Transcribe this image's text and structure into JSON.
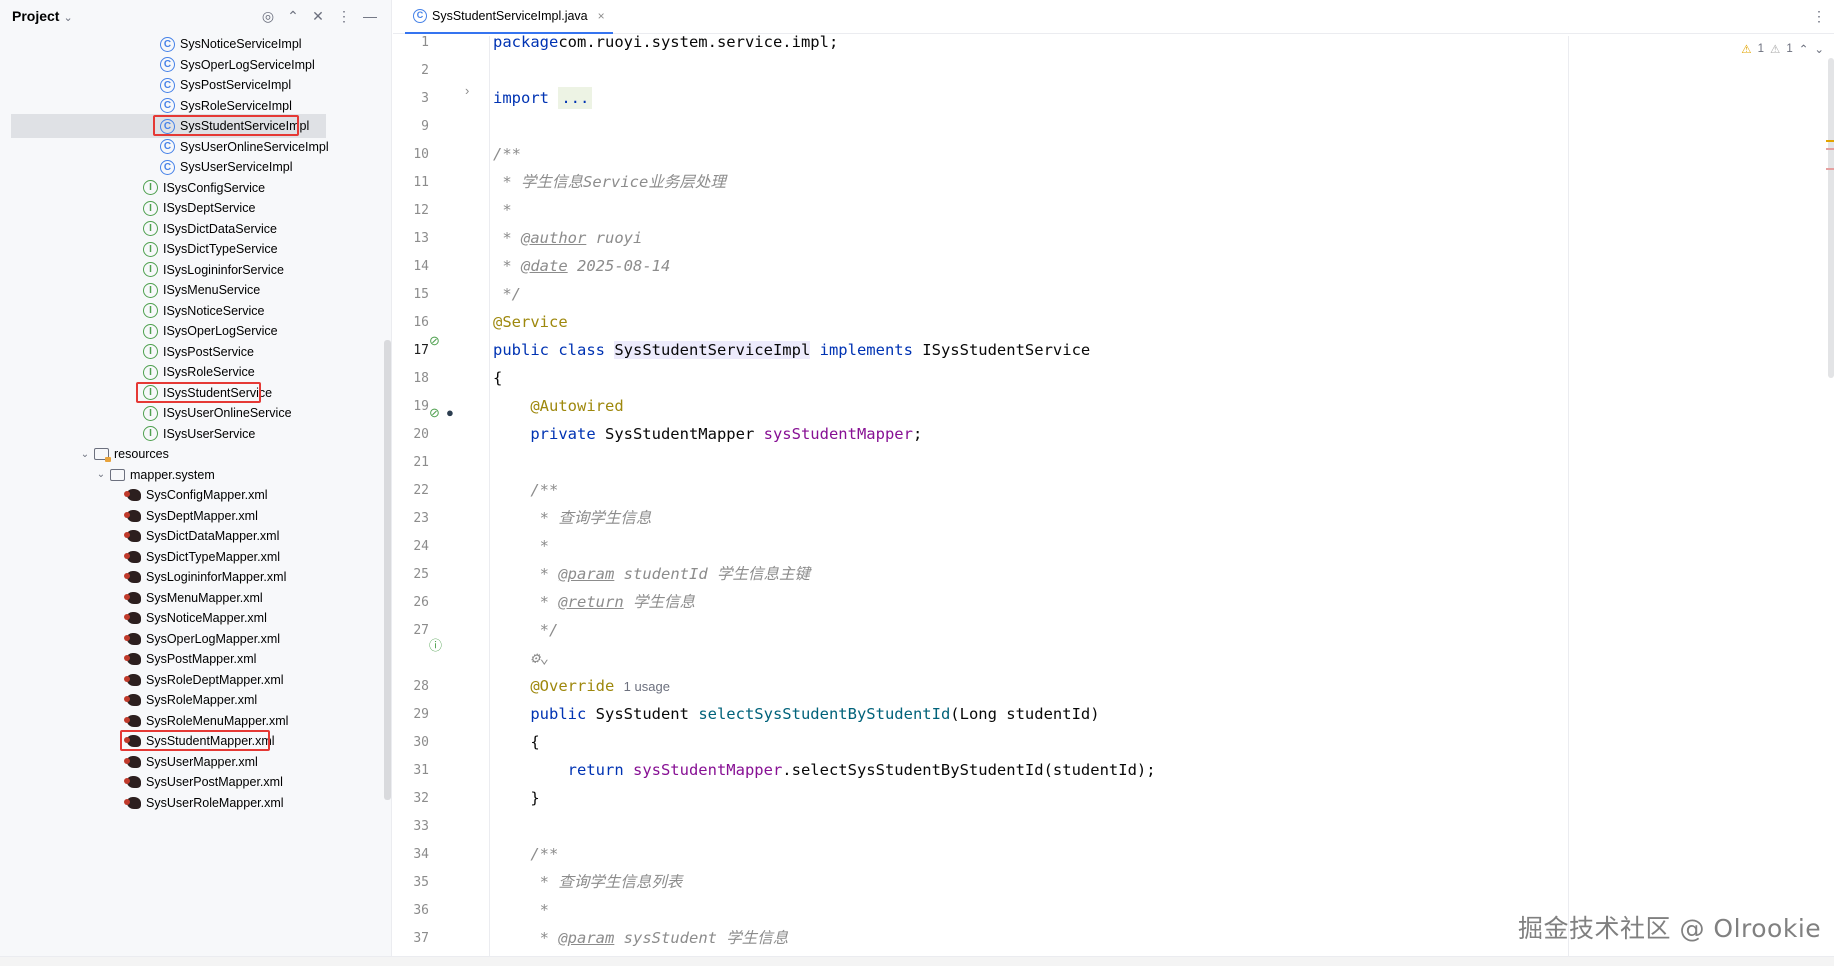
{
  "project_panel": {
    "title": "Project",
    "header_icons": [
      "locate-icon",
      "expand-icon",
      "collapse-icon",
      "more-icon",
      "minimize-icon"
    ],
    "tree": [
      {
        "label": "SysNoticeServiceImpl",
        "kind": "class"
      },
      {
        "label": "SysOperLogServiceImpl",
        "kind": "class"
      },
      {
        "label": "SysPostServiceImpl",
        "kind": "class"
      },
      {
        "label": "SysRoleServiceImpl",
        "kind": "class"
      },
      {
        "label": "SysStudentServiceImpl",
        "kind": "class",
        "selected": true,
        "highlighted": true
      },
      {
        "label": "SysUserOnlineServiceImpl",
        "kind": "class"
      },
      {
        "label": "SysUserServiceImpl",
        "kind": "class"
      },
      {
        "label": "ISysConfigService",
        "kind": "interface"
      },
      {
        "label": "ISysDeptService",
        "kind": "interface"
      },
      {
        "label": "ISysDictDataService",
        "kind": "interface"
      },
      {
        "label": "ISysDictTypeService",
        "kind": "interface"
      },
      {
        "label": "ISysLogininforService",
        "kind": "interface"
      },
      {
        "label": "ISysMenuService",
        "kind": "interface"
      },
      {
        "label": "ISysNoticeService",
        "kind": "interface"
      },
      {
        "label": "ISysOperLogService",
        "kind": "interface"
      },
      {
        "label": "ISysPostService",
        "kind": "interface"
      },
      {
        "label": "ISysRoleService",
        "kind": "interface"
      },
      {
        "label": "ISysStudentService",
        "kind": "interface",
        "highlighted": true
      },
      {
        "label": "ISysUserOnlineService",
        "kind": "interface"
      },
      {
        "label": "ISysUserService",
        "kind": "interface"
      },
      {
        "label": "resources",
        "kind": "folder-resources",
        "expanded": true
      },
      {
        "label": "mapper.system",
        "kind": "folder",
        "expanded": true
      },
      {
        "label": "SysConfigMapper.xml",
        "kind": "xml"
      },
      {
        "label": "SysDeptMapper.xml",
        "kind": "xml"
      },
      {
        "label": "SysDictDataMapper.xml",
        "kind": "xml"
      },
      {
        "label": "SysDictTypeMapper.xml",
        "kind": "xml"
      },
      {
        "label": "SysLogininforMapper.xml",
        "kind": "xml"
      },
      {
        "label": "SysMenuMapper.xml",
        "kind": "xml"
      },
      {
        "label": "SysNoticeMapper.xml",
        "kind": "xml"
      },
      {
        "label": "SysOperLogMapper.xml",
        "kind": "xml"
      },
      {
        "label": "SysPostMapper.xml",
        "kind": "xml"
      },
      {
        "label": "SysRoleDeptMapper.xml",
        "kind": "xml"
      },
      {
        "label": "SysRoleMapper.xml",
        "kind": "xml"
      },
      {
        "label": "SysRoleMenuMapper.xml",
        "kind": "xml"
      },
      {
        "label": "SysStudentMapper.xml",
        "kind": "xml",
        "highlighted": true
      },
      {
        "label": "SysUserMapper.xml",
        "kind": "xml"
      },
      {
        "label": "SysUserPostMapper.xml",
        "kind": "xml"
      },
      {
        "label": "SysUserRoleMapper.xml",
        "kind": "xml"
      }
    ]
  },
  "editor": {
    "tab": {
      "label": "SysStudentServiceImpl.java",
      "close": "×"
    },
    "inspections": {
      "warnings": "1",
      "weak_warnings": "1",
      "warn_glyph": "⚠"
    },
    "code_lines": [
      {
        "n": "1",
        "tokens": [
          [
            "kw",
            "package"
          ],
          [
            "",
            "com.ruoyi.system.service.impl;"
          ]
        ]
      },
      {
        "n": "2",
        "tokens": []
      },
      {
        "n": "3",
        "tokens": [
          [
            "kw",
            "import"
          ],
          [
            "",
            " "
          ],
          [
            "fold",
            "..."
          ]
        ]
      },
      {
        "n": "9",
        "tokens": []
      },
      {
        "n": "10",
        "tokens": [
          [
            "cmt",
            "/**"
          ]
        ]
      },
      {
        "n": "11",
        "tokens": [
          [
            "cmt",
            " * 学生信息Service业务层处理"
          ]
        ]
      },
      {
        "n": "12",
        "tokens": [
          [
            "cmt",
            " *"
          ]
        ]
      },
      {
        "n": "13",
        "tokens": [
          [
            "cmt",
            " * "
          ],
          [
            "doctag",
            "@author"
          ],
          [
            "cmt",
            " ruoyi"
          ]
        ]
      },
      {
        "n": "14",
        "tokens": [
          [
            "cmt",
            " * "
          ],
          [
            "doctag",
            "@date"
          ],
          [
            "cmt",
            " 2025-08-14"
          ]
        ]
      },
      {
        "n": "15",
        "tokens": [
          [
            "cmt",
            " */"
          ]
        ]
      },
      {
        "n": "16",
        "tokens": [
          [
            "ann",
            "@Service"
          ]
        ]
      },
      {
        "n": "17",
        "tokens": [
          [
            "kw",
            "public class "
          ],
          [
            "hl-cls",
            "SysStudentServiceImpl"
          ],
          [
            "kw",
            " implements "
          ],
          [
            "",
            "ISysStudentService"
          ]
        ]
      },
      {
        "n": "18",
        "tokens": [
          [
            "",
            "{"
          ]
        ]
      },
      {
        "n": "19",
        "tokens": [
          [
            "",
            "    "
          ],
          [
            "ann",
            "@Autowired"
          ]
        ]
      },
      {
        "n": "20",
        "tokens": [
          [
            "",
            "    "
          ],
          [
            "kw",
            "private "
          ],
          [
            "",
            "SysStudentMapper "
          ],
          [
            "field",
            "sysStudentMapper"
          ],
          [
            "",
            ";"
          ]
        ]
      },
      {
        "n": "21",
        "tokens": []
      },
      {
        "n": "22",
        "tokens": [
          [
            "cmt",
            "    /**"
          ]
        ]
      },
      {
        "n": "23",
        "tokens": [
          [
            "cmt",
            "     * 查询学生信息"
          ]
        ]
      },
      {
        "n": "24",
        "tokens": [
          [
            "cmt",
            "     *"
          ]
        ]
      },
      {
        "n": "25",
        "tokens": [
          [
            "cmt",
            "     * "
          ],
          [
            "doctag",
            "@param"
          ],
          [
            "cmt",
            " studentId 学生信息主键"
          ]
        ]
      },
      {
        "n": "26",
        "tokens": [
          [
            "cmt",
            "     * "
          ],
          [
            "doctag",
            "@return"
          ],
          [
            "cmt",
            " 学生信息"
          ]
        ]
      },
      {
        "n": "27",
        "tokens": [
          [
            "cmt",
            "     */"
          ]
        ]
      },
      {
        "n": "",
        "tokens": [
          [
            "cmt",
            "    ⚙⌄"
          ]
        ]
      },
      {
        "n": "28",
        "tokens": [
          [
            "",
            "    "
          ],
          [
            "ann",
            "@Override"
          ],
          [
            "",
            " "
          ],
          [
            "hint",
            "1 usage"
          ]
        ]
      },
      {
        "n": "29",
        "tokens": [
          [
            "",
            "    "
          ],
          [
            "kw",
            "public "
          ],
          [
            "",
            "SysStudent "
          ],
          [
            "meth",
            "selectSysStudentByStudentId"
          ],
          [
            "",
            "(Long studentId)"
          ]
        ]
      },
      {
        "n": "30",
        "tokens": [
          [
            "",
            "    {"
          ]
        ]
      },
      {
        "n": "31",
        "tokens": [
          [
            "",
            "        "
          ],
          [
            "kw",
            "return "
          ],
          [
            "field",
            "sysStudentMapper"
          ],
          [
            "",
            ".selectSysStudentByStudentId(studentId);"
          ]
        ]
      },
      {
        "n": "32",
        "tokens": [
          [
            "",
            "    }"
          ]
        ]
      },
      {
        "n": "33",
        "tokens": []
      },
      {
        "n": "34",
        "tokens": [
          [
            "cmt",
            "    /**"
          ]
        ]
      },
      {
        "n": "35",
        "tokens": [
          [
            "cmt",
            "     * 查询学生信息列表"
          ]
        ]
      },
      {
        "n": "36",
        "tokens": [
          [
            "cmt",
            "     *"
          ]
        ]
      },
      {
        "n": "37",
        "tokens": [
          [
            "cmt",
            "     * "
          ],
          [
            "doctag",
            "@param"
          ],
          [
            "cmt",
            " sysStudent 学生信息"
          ]
        ]
      }
    ]
  },
  "watermark": "掘金技术社区 @ Olrookie",
  "colors": {
    "accent": "#3574f0",
    "highlight_box": "#e53935",
    "keyword": "#0033b3",
    "annotation": "#9e880d",
    "comment": "#8c8c8c",
    "field": "#871094",
    "method": "#00627a"
  }
}
